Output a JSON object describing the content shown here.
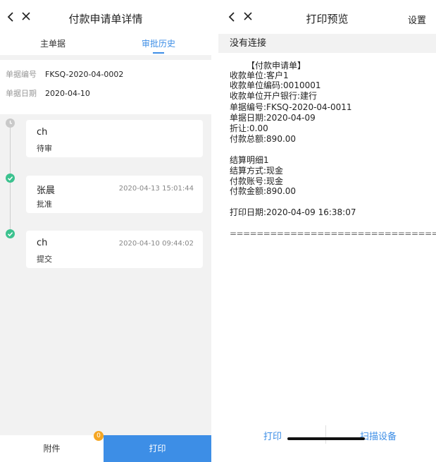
{
  "left": {
    "title": "付款申请单详情",
    "tabs": [
      {
        "label": "主单据",
        "active": false
      },
      {
        "label": "审批历史",
        "active": true
      }
    ],
    "info": {
      "doc_no_label": "单据编号",
      "doc_no": "FKSQ-2020-04-0002",
      "doc_date_label": "单据日期",
      "doc_date": "2020-04-10"
    },
    "timeline": [
      {
        "name": "ch",
        "status": "待审",
        "time": "",
        "state": "pending"
      },
      {
        "name": "张晨",
        "status": "批准",
        "time": "2020-04-13 15:01:44",
        "state": "done"
      },
      {
        "name": "ch",
        "status": "提交",
        "time": "2020-04-10 09:44:02",
        "state": "done"
      }
    ],
    "bottom": {
      "attach_label": "附件",
      "badge_count": "0",
      "print_label": "打印"
    }
  },
  "right": {
    "title": "打印预览",
    "settings_label": "设置",
    "connection_status": "没有连接",
    "receipt": {
      "heading": "【付款申请单】",
      "lines_a": [
        "收款单位:客户1",
        "收款单位编码:0010001",
        "收款单位开户银行:建行",
        "单据编号:FKSQ-2020-04-0011",
        "单据日期:2020-04-09",
        "折让:0.00",
        "付款总额:890.00"
      ],
      "lines_b": [
        "结算明细1",
        "结算方式:现金",
        "付款账号:现金",
        "付款金额:890.00"
      ],
      "print_date": "打印日期:2020-04-09 16:38:07",
      "separator": "================================"
    },
    "footer": {
      "print_label": "打印",
      "scan_label": "扫描设备"
    }
  },
  "colors": {
    "accent": "#3d8ee6",
    "success": "#3cc28f",
    "badge": "#f5a623",
    "background": "#f2f2f2"
  },
  "icons": [
    "back-icon",
    "close-icon",
    "clock-icon",
    "check-icon"
  ]
}
